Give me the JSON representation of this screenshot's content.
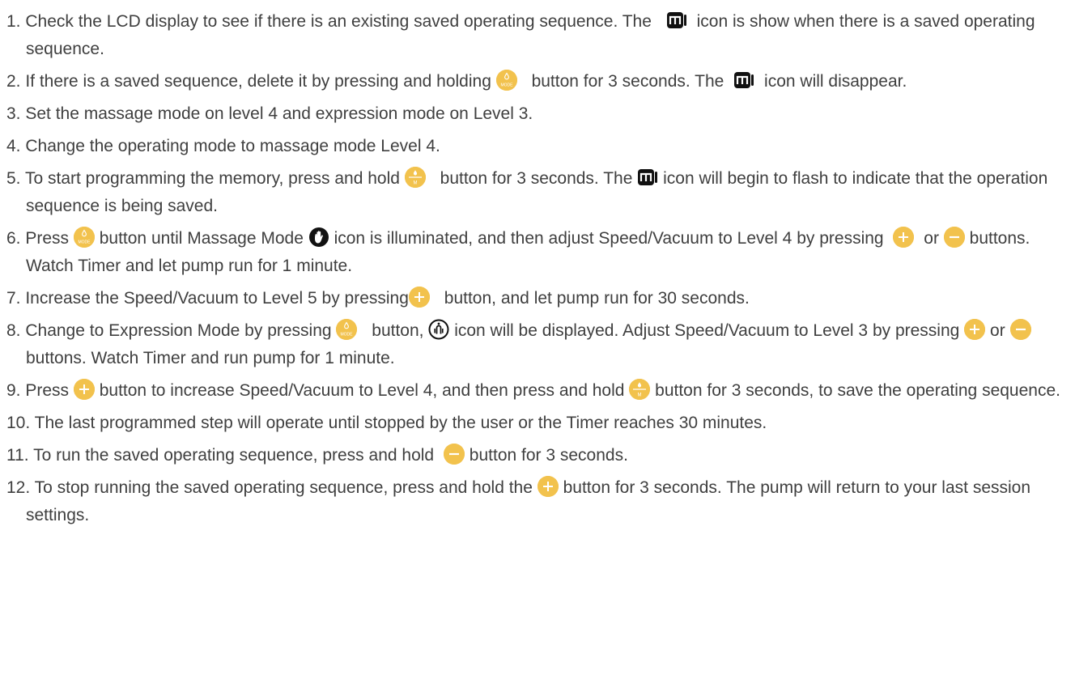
{
  "steps": [
    {
      "t1": "1. Check the LCD display to see if there is an existing saved operating sequence. The",
      "t2": "icon is show when there is a saved operating sequence."
    },
    {
      "t1": "2. If there is a saved sequence, delete it by pressing and holding",
      "t2": "button for 3 seconds. The",
      "t3": "icon will disappear."
    },
    {
      "t1": "3. Set the massage mode on level 4 and expression mode on Level 3."
    },
    {
      "t1": "4. Change the operating mode to massage mode Level 4."
    },
    {
      "t1": "5. To start programming the memory, press and hold",
      "t2": "button for 3 seconds. The",
      "t3": "icon will begin to flash to indicate that the operation sequence is being saved."
    },
    {
      "t1": "6. Press",
      "t2": "button until Massage Mode",
      "t3": "icon is illuminated, and then adjust Speed/Vacuum to Level 4 by pressing",
      "t4": "or",
      "t5": "buttons. Watch Timer and let pump run for 1 minute."
    },
    {
      "t1": "7. Increase the Speed/Vacuum to Level 5 by pressing",
      "t2": "button, and let pump run for 30 seconds."
    },
    {
      "t1": "8. Change to Expression Mode by pressing",
      "t2": "button,",
      "t3": "icon will be displayed. Adjust Speed/Vacuum to Level 3 by pressing",
      "t4": "or",
      "t5": "buttons. Watch Timer and run pump for 1 minute."
    },
    {
      "t1": "9. Press",
      "t2": "button to increase Speed/Vacuum to Level 4, and then press and hold",
      "t3": "button for 3 seconds, to save the operating sequence."
    },
    {
      "t1": "10. The last programmed step will operate until stopped by the user or the Timer reaches 30 minutes."
    },
    {
      "t1": "11. To run the saved operating sequence, press and hold",
      "t2": "button for 3 seconds."
    },
    {
      "t1": "12. To stop running the saved operating sequence, press and hold the",
      "t2": "button for 3 seconds. The pump will return to your last session settings."
    }
  ],
  "icons": {
    "mode_button_label": "MODE",
    "memory_button_label": "M",
    "button_color": "#f2c24d",
    "text_color": "#3f3f3f"
  }
}
